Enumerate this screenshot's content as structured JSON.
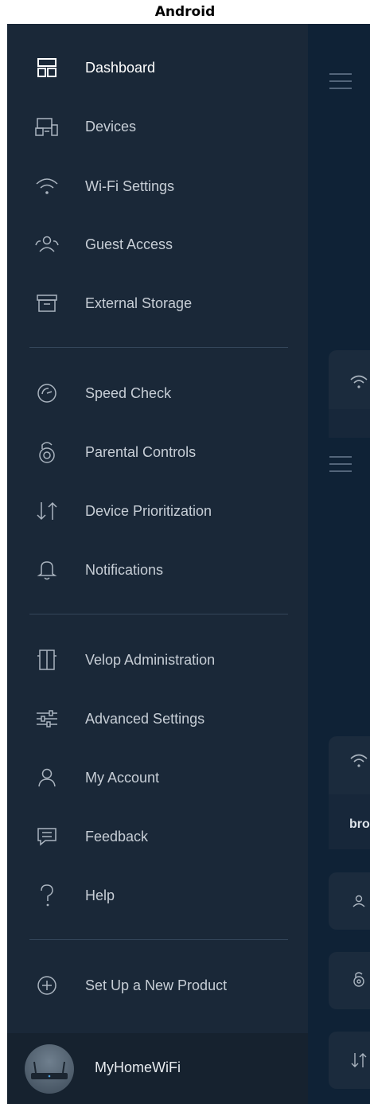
{
  "platform_label": "Android",
  "drawer": {
    "items": [
      {
        "label": "Dashboard",
        "icon": "dashboard-icon",
        "active": true
      },
      {
        "label": "Devices",
        "icon": "devices-icon"
      },
      {
        "label": "Wi-Fi Settings",
        "icon": "wifi-icon"
      },
      {
        "label": "Guest Access",
        "icon": "guest-access-icon"
      },
      {
        "label": "External Storage",
        "icon": "storage-icon"
      },
      {
        "label": "Speed Check",
        "icon": "speedometer-icon"
      },
      {
        "label": "Parental Controls",
        "icon": "parental-lock-icon"
      },
      {
        "label": "Device Prioritization",
        "icon": "prioritization-arrows-icon"
      },
      {
        "label": "Notifications",
        "icon": "bell-icon"
      },
      {
        "label": "Velop Administration",
        "icon": "velop-node-icon"
      },
      {
        "label": "Advanced Settings",
        "icon": "sliders-icon"
      },
      {
        "label": "My Account",
        "icon": "person-icon"
      },
      {
        "label": "Feedback",
        "icon": "chat-bubble-icon"
      },
      {
        "label": "Help",
        "icon": "question-mark-icon"
      },
      {
        "label": "Set Up a New Product",
        "icon": "plus-circle-icon"
      }
    ],
    "footer": {
      "network_name": "MyHomeWiFi",
      "icon": "router-avatar-icon"
    }
  },
  "background": {
    "peek_text": "bro"
  },
  "colors": {
    "drawer_bg": "#1a2838",
    "screen_bg": "#0f2236",
    "text": "#c7ced6",
    "text_active": "#ffffff",
    "icon": "#aab4bf"
  }
}
